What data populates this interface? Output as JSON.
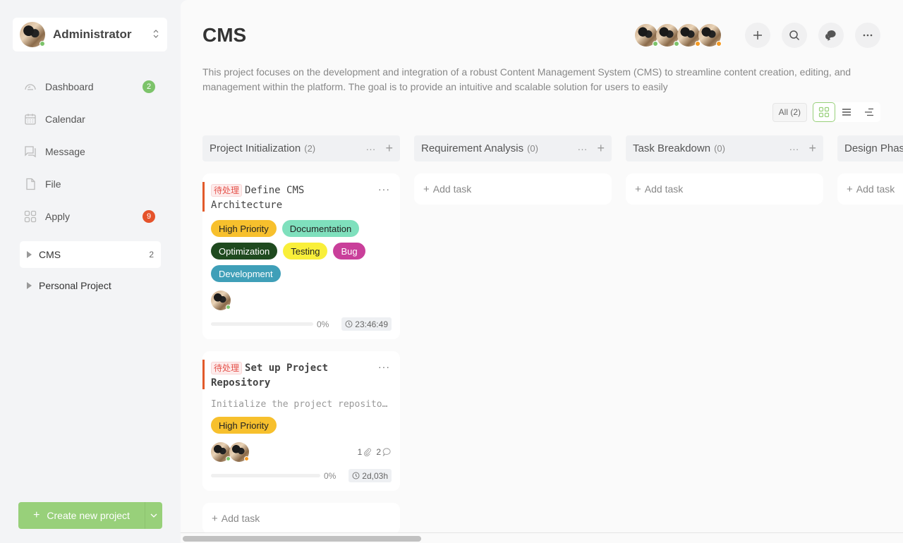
{
  "user": {
    "name": "Administrator",
    "status_color": "#7cc36a"
  },
  "sidebar": {
    "nav": [
      {
        "label": "Dashboard",
        "icon": "dashboard-icon",
        "badge": "2",
        "badge_color": "#7cc36a"
      },
      {
        "label": "Calendar",
        "icon": "calendar-icon",
        "badge": null
      },
      {
        "label": "Message",
        "icon": "message-icon",
        "badge": null
      },
      {
        "label": "File",
        "icon": "file-icon",
        "badge": null
      },
      {
        "label": "Apply",
        "icon": "apps-icon",
        "badge": "9",
        "badge_color": "#e5532b"
      }
    ],
    "projects": [
      {
        "label": "CMS",
        "count": "2",
        "active": true
      },
      {
        "label": "Personal Project",
        "count": "",
        "active": false
      }
    ],
    "create_label": "Create new project"
  },
  "header": {
    "title": "CMS",
    "description": "This project focuses on the development and integration of a robust Content Management System (CMS) to streamline content creation, editing, and management within the platform. The goal is to provide an intuitive and scalable solution for users to easily",
    "members": [
      {
        "status": "green"
      },
      {
        "status": "green"
      },
      {
        "status": "orange"
      },
      {
        "status": "orange"
      }
    ]
  },
  "filter": {
    "all_label": "All (2)",
    "views": [
      "board-view",
      "list-view",
      "gantt-view"
    ],
    "active_view": "board-view"
  },
  "columns": [
    {
      "title": "Project Initialization",
      "count": "(2)",
      "cards": [
        {
          "status": "待处理",
          "title": "Define CMS Architecture",
          "bold": false,
          "description": null,
          "tags": [
            {
              "label": "High Priority",
              "bg": "#f7c02d",
              "fg": "#222"
            },
            {
              "label": "Documentation",
              "bg": "#7fe0bd",
              "fg": "#222"
            },
            {
              "label": "Optimization",
              "bg": "#1f4a1f",
              "fg": "#fff"
            },
            {
              "label": "Testing",
              "bg": "#f9ef3a",
              "fg": "#222"
            },
            {
              "label": "Bug",
              "bg": "#c93f9a",
              "fg": "#fff"
            },
            {
              "label": "Development",
              "bg": "#3f9fb8",
              "fg": "#fff"
            }
          ],
          "assignees": [
            "green"
          ],
          "attachments": null,
          "comments": null,
          "progress": "0%",
          "time": "23:46:49"
        },
        {
          "status": "待处理",
          "title": "Set up Project Repository",
          "bold": true,
          "description": "Initialize the project repository",
          "tags": [
            {
              "label": "High Priority",
              "bg": "#f7c02d",
              "fg": "#222"
            }
          ],
          "assignees": [
            "green",
            "orange"
          ],
          "attachments": "1",
          "comments": "2",
          "progress": "0%",
          "time": "2d,03h"
        }
      ],
      "add_label": "Add task"
    },
    {
      "title": "Requirement Analysis",
      "count": "(0)",
      "cards": [],
      "add_label": "Add task"
    },
    {
      "title": "Task Breakdown",
      "count": "(0)",
      "cards": [],
      "add_label": "Add task"
    },
    {
      "title": "Design Phase",
      "count": "",
      "cards": [],
      "add_label": "Add task"
    }
  ],
  "colors": {
    "accent": "#98d07a",
    "danger": "#e25a2b"
  }
}
